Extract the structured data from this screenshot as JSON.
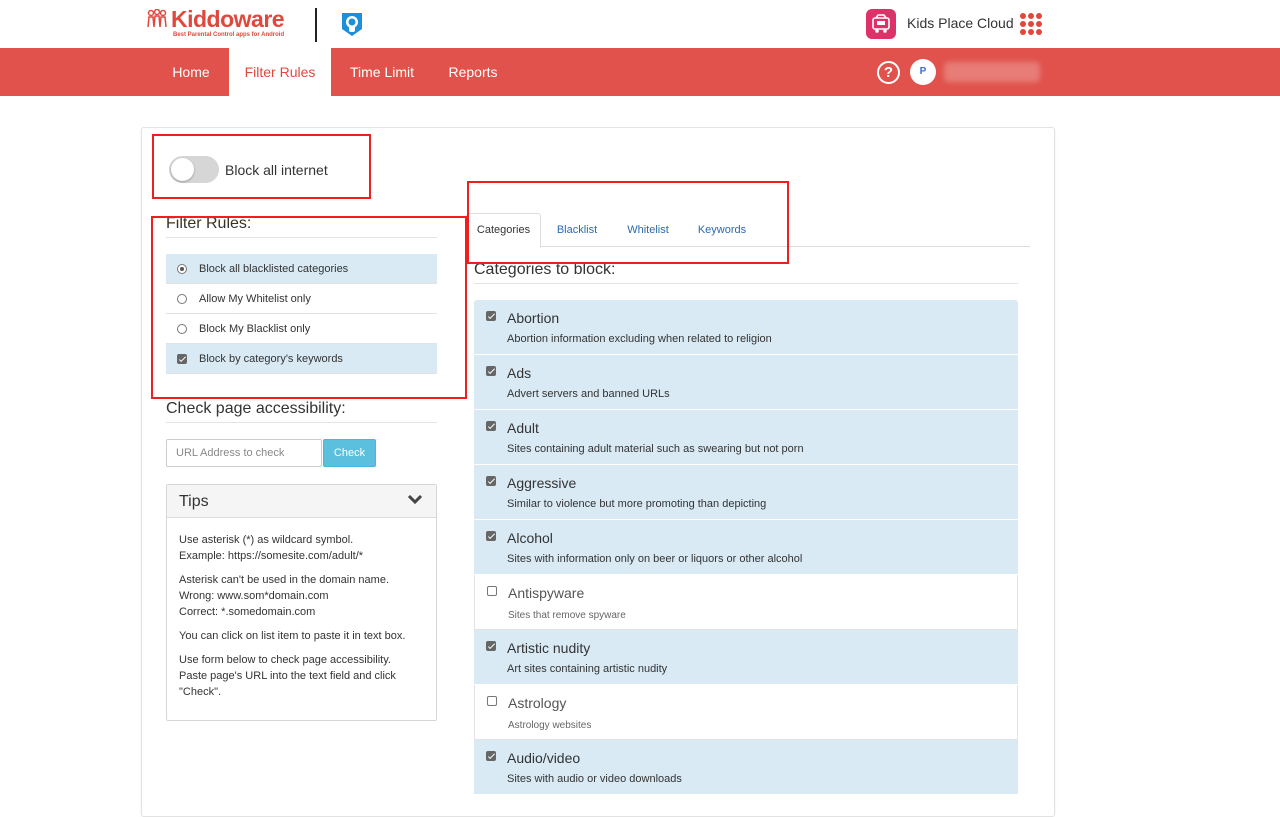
{
  "header": {
    "brand": "Kiddoware",
    "brand_tagline": "Best Parental Control apps for Android",
    "cloud_label": "Kids Place Cloud"
  },
  "nav": {
    "items": [
      "Home",
      "Filter Rules",
      "Time Limit",
      "Reports"
    ],
    "active": "Filter Rules",
    "help": "?",
    "avatar_initial": "P"
  },
  "block_internet": {
    "label": "Block all internet",
    "on": false
  },
  "filter_rules": {
    "title": "Filter Rules:",
    "options": [
      {
        "label": "Block all blacklisted categories",
        "type": "radio",
        "selected": true
      },
      {
        "label": "Allow My Whitelist only",
        "type": "radio",
        "selected": false
      },
      {
        "label": "Block My Blacklist only",
        "type": "radio",
        "selected": false
      },
      {
        "label": "Block by category's keywords",
        "type": "checkbox",
        "selected": true
      }
    ]
  },
  "accessibility": {
    "title": "Check page accessibility:",
    "placeholder": "URL Address to check",
    "value": "",
    "button": "Check"
  },
  "tips": {
    "title": "Tips",
    "paragraphs": [
      [
        "Use asterisk (*) as wildcard symbol.",
        "Example: https://somesite.com/adult/*"
      ],
      [
        "Asterisk can't be used in the domain name.",
        "Wrong: www.som*domain.com",
        "Correct: *.somedomain.com"
      ],
      [
        "You can click on list item to paste it in text box."
      ],
      [
        "Use form below to check page accessibility.",
        "Paste page's URL into the text field and click",
        "\"Check\"."
      ]
    ]
  },
  "tabs": {
    "items": [
      "Categories",
      "Blacklist",
      "Whitelist",
      "Keywords"
    ],
    "active": "Categories"
  },
  "categories": {
    "title": "Categories to block:",
    "items": [
      {
        "name": "Abortion",
        "desc": "Abortion information excluding when related to religion",
        "checked": true
      },
      {
        "name": "Ads",
        "desc": "Advert servers and banned URLs",
        "checked": true
      },
      {
        "name": "Adult",
        "desc": "Sites containing adult material such as swearing but not porn",
        "checked": true
      },
      {
        "name": "Aggressive",
        "desc": "Similar to violence but more promoting than depicting",
        "checked": true
      },
      {
        "name": "Alcohol",
        "desc": "Sites with information only on beer or liquors or other alcohol",
        "checked": true
      },
      {
        "name": "Antispyware",
        "desc": "Sites that remove spyware",
        "checked": false
      },
      {
        "name": "Artistic nudity",
        "desc": "Art sites containing artistic nudity",
        "checked": true
      },
      {
        "name": "Astrology",
        "desc": "Astrology websites",
        "checked": false
      },
      {
        "name": "Audio/video",
        "desc": "Sites with audio or video downloads",
        "checked": true
      }
    ]
  },
  "colors": {
    "brand_red": "#e0524b",
    "highlight_blue": "#d9eaf4",
    "annotation_red": "#f01e1e",
    "check_button": "#5bc0de"
  }
}
